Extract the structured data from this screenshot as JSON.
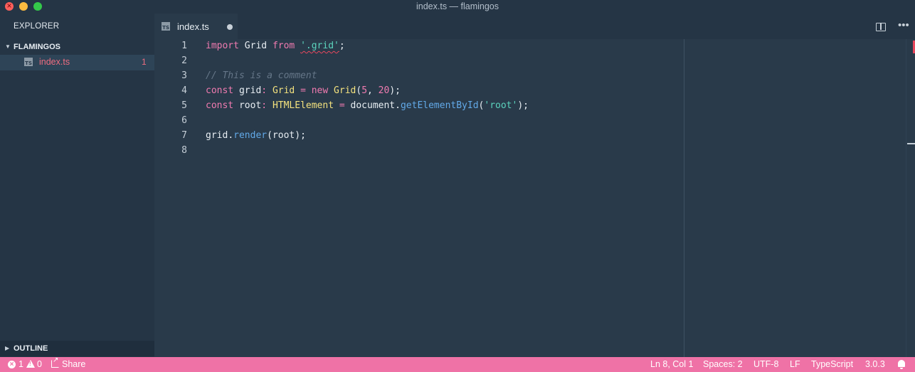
{
  "window": {
    "title": "index.ts — flamingos"
  },
  "sidebar": {
    "title": "EXPLORER",
    "folder": "FLAMINGOS",
    "files": [
      {
        "name": "index.ts",
        "problems": "1",
        "icon": "typescript-file-icon"
      }
    ],
    "outline": "OUTLINE"
  },
  "tabs": [
    {
      "label": "index.ts",
      "dirty": true,
      "icon": "typescript-file-icon"
    }
  ],
  "editor": {
    "lines": [
      {
        "n": "1"
      },
      {
        "n": "2"
      },
      {
        "n": "3"
      },
      {
        "n": "4"
      },
      {
        "n": "5"
      },
      {
        "n": "6"
      },
      {
        "n": "7"
      },
      {
        "n": "8"
      }
    ],
    "tokens": {
      "l1": {
        "import": "import",
        "grid": "Grid",
        "from": "from",
        "path": "'.grid'",
        "semi": ";"
      },
      "l3": {
        "comment": "// This is a comment"
      },
      "l4": {
        "const": "const",
        "name": "grid",
        "colon": ":",
        "type": "Grid",
        "eq": "=",
        "new": "new",
        "ctor": "Grid",
        "open": "(",
        "a": "5",
        "comma": ", ",
        "b": "20",
        "close": ");"
      },
      "l5": {
        "const": "const",
        "name": "root",
        "colon": ":",
        "type": "HTMLElement",
        "eq": "=",
        "obj": "document",
        "dot": ".",
        "method": "getElementById",
        "open": "(",
        "arg": "'root'",
        "close": ");"
      },
      "l7": {
        "obj": "grid",
        "dot": ".",
        "method": "render",
        "args": "(root);"
      }
    }
  },
  "statusbar": {
    "errors": "1",
    "warnings": "0",
    "share": "Share",
    "position": "Ln 8, Col 1",
    "spaces": "Spaces: 2",
    "encoding": "UTF-8",
    "eol": "LF",
    "language": "TypeScript",
    "version": "3.0.3"
  },
  "colors": {
    "background": "#293A4A",
    "sidebar": "#253545",
    "statusbar": "#EF72A6",
    "error": "#E8475D",
    "keyword": "#F07BB0",
    "type": "#F4E27E",
    "string": "#5CD4BE",
    "function": "#62A9E8"
  }
}
